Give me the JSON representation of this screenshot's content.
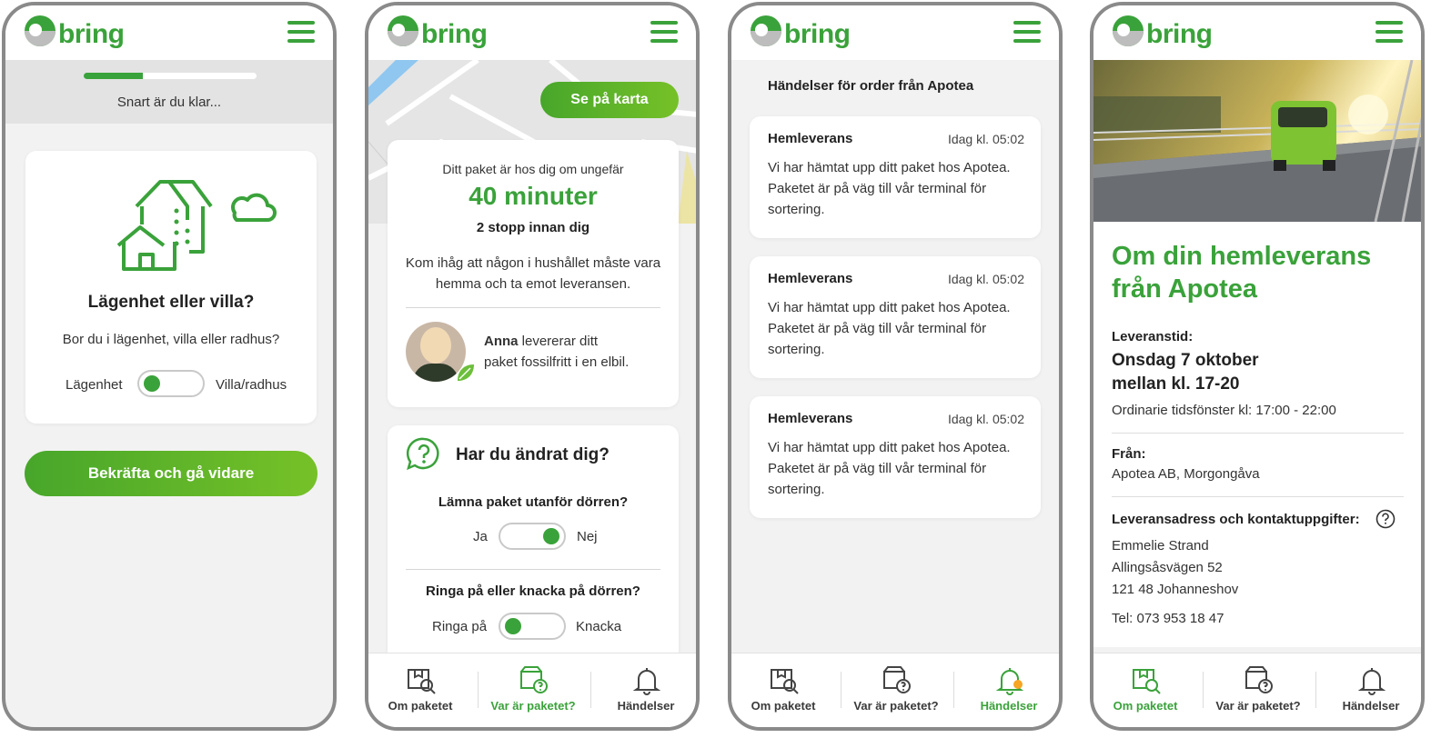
{
  "brand": {
    "name": "bring",
    "primary_color": "#3aa23a",
    "accent_color": "#f5a623"
  },
  "screen1": {
    "progress_fraction": 0.34,
    "progress_text": "Snart är du klar...",
    "card_title": "Lägenhet eller villa?",
    "card_question": "Bor du i lägenhet, villa eller radhus?",
    "toggle_left": "Lägenhet",
    "toggle_right": "Villa/radhus",
    "confirm_button": "Bekräfta och gå vidare"
  },
  "screen2": {
    "map_button": "Se på karta",
    "eta_intro": "Ditt paket är hos dig om ungefär",
    "eta_value": "40 minuter",
    "stops": "2 stopp innan dig",
    "reminder": "Kom ihåg att någon i hushållet måste vara hemma och ta emot leveransen.",
    "driver_name": "Anna",
    "driver_text_1": " levererar ditt",
    "driver_text_2": "paket fossilfritt i en elbil.",
    "changed_title": "Har du ändrat dig?",
    "q1": "Lämna paket utanför dörren?",
    "q1_left": "Ja",
    "q1_right": "Nej",
    "q2": "Ringa på eller knacka på dörren?",
    "q2_left": "Ringa på",
    "q2_right": "Knacka"
  },
  "screen3": {
    "heading": "Händelser för order från Apotea",
    "events": [
      {
        "title": "Hemleverans",
        "time": "Idag kl. 05:02",
        "line1": "Vi har hämtat upp ditt paket hos Apotea.",
        "line2": "Paketet är på väg till vår terminal för",
        "line3": "sortering."
      },
      {
        "title": "Hemleverans",
        "time": "Idag kl. 05:02",
        "line1": "Vi har hämtat upp ditt paket hos Apotea.",
        "line2": "Paketet är på väg till vår terminal för",
        "line3": "sortering."
      },
      {
        "title": "Hemleverans",
        "time": "Idag kl. 05:02",
        "line1": "Vi har hämtat upp ditt paket hos Apotea.",
        "line2": "Paketet är på väg till vår terminal för",
        "line3": "sortering."
      }
    ]
  },
  "screen4": {
    "title_line1": "Om din hemleverans",
    "title_line2": "från Apotea",
    "time_label": "Leveranstid:",
    "time_value_1": "Onsdag 7 oktober",
    "time_value_2": "mellan kl. 17-20",
    "time_window": "Ordinarie tidsfönster kl: 17:00 - 22:00",
    "from_label": "Från:",
    "from_value": "Apotea AB, Morgongåva",
    "address_label": "Leveransadress och kontaktuppgifter:",
    "address_name": "Emmelie Strand",
    "address_street": "Allingsåsvägen 52",
    "address_city": "121 48 Johanneshov",
    "phone": "Tel: 073 953 18 47"
  },
  "nav": {
    "om_paketet": "Om paketet",
    "var_ar": "Var är paketet?",
    "handelser": "Händelser"
  }
}
